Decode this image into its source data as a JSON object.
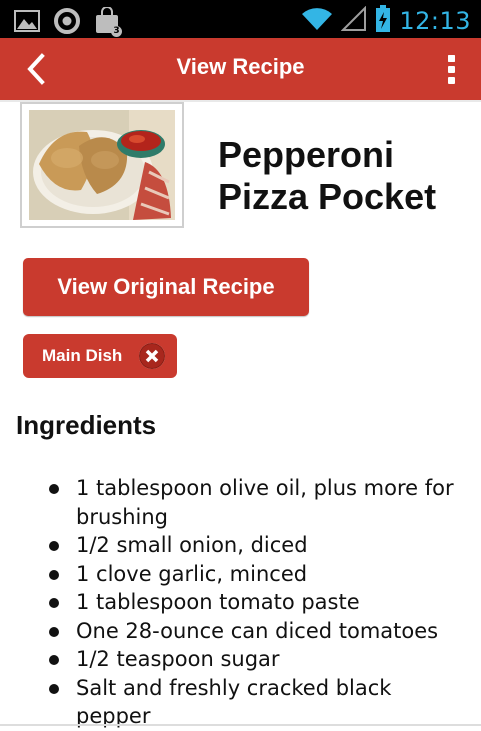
{
  "status_bar": {
    "time": "12:13",
    "icons": [
      "gallery-icon",
      "chrome-icon",
      "shopping-bag-icon",
      "wifi-icon",
      "signal-icon",
      "battery-charging-icon"
    ],
    "notification_badge": "3"
  },
  "action_bar": {
    "title": "View Recipe",
    "back_icon": "chevron-left-icon",
    "overflow_icon": "overflow-menu-icon",
    "color": "#c93a2e"
  },
  "recipe": {
    "title": "Pepperoni Pizza Pocket",
    "image_alt": "pizza-pocket-photo",
    "view_original_label": "View Original Recipe",
    "tag": {
      "label": "Main Dish",
      "remove_icon": "close-icon"
    }
  },
  "ingredients": {
    "heading": "Ingredients",
    "items": [
      "1 tablespoon olive oil, plus more for brushing",
      "1/2 small onion, diced",
      "1 clove garlic, minced",
      "1 tablespoon tomato paste",
      "One 28-ounce can diced tomatoes",
      "1/2 teaspoon sugar",
      "Salt and freshly cracked black pepper"
    ]
  },
  "colors": {
    "accent": "#c93a2e",
    "status_icons": "#33b5e5",
    "text": "#111111"
  }
}
